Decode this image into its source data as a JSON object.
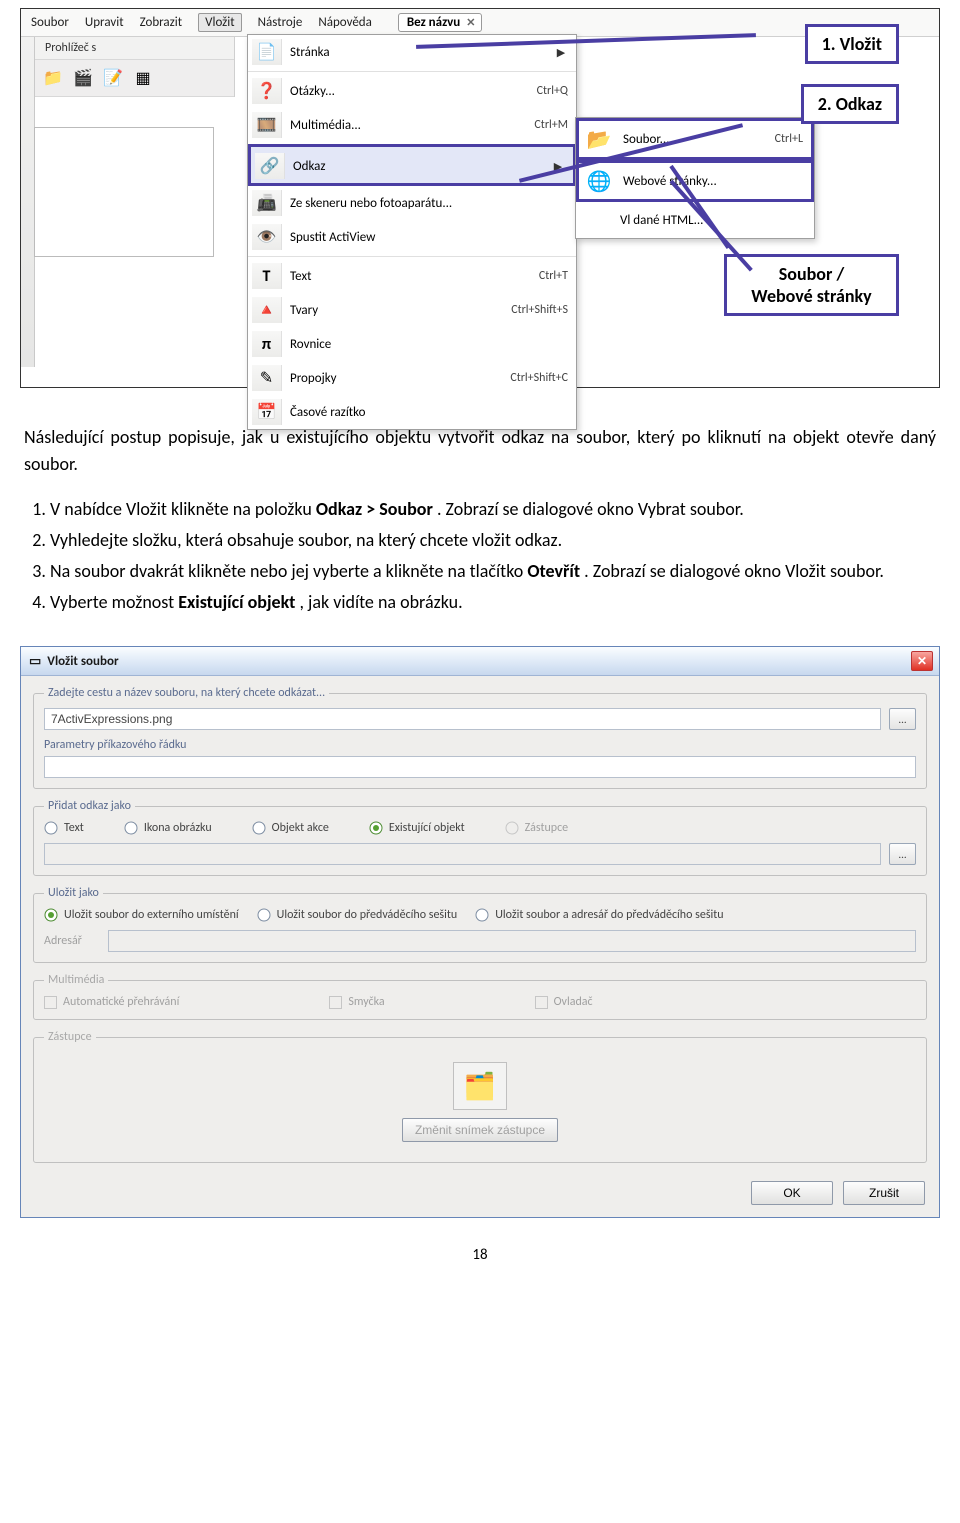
{
  "menubar": {
    "file": "Soubor",
    "edit": "Upravit",
    "view": "Zobrazit",
    "insert": "Vložit",
    "tools": "Nástroje",
    "help": "Nápověda",
    "tab_name": "Bez názvu"
  },
  "side_panel": {
    "title": "Prohlížeč s"
  },
  "dropdown": {
    "page": "Stránka",
    "questions": "Otázky...",
    "questions_sc": "Ctrl+Q",
    "multimedia": "Multimédia...",
    "multimedia_sc": "Ctrl+M",
    "link": "Odkaz",
    "scanner": "Ze skeneru nebo fotoaparátu...",
    "actiview": "Spustit ActiView",
    "text": "Text",
    "text_sc": "Ctrl+T",
    "shapes": "Tvary",
    "shapes_sc": "Ctrl+Shift+S",
    "equation": "Rovnice",
    "connectors": "Propojky",
    "connectors_sc": "Ctrl+Shift+C",
    "timestamp": "Časové razítko"
  },
  "submenu": {
    "file": "Soubor...",
    "file_sc": "Ctrl+L",
    "web": "Webové stránky...",
    "html": "Vl   dané HTML..."
  },
  "callouts": {
    "c1": "1. Vložit",
    "c2": "2. Odkaz",
    "c3_line1": "Soubor /",
    "c3_line2": "Webové stránky"
  },
  "body": {
    "intro": "Následující postup popisuje, jak u existujícího objektu vytvořit odkaz na soubor, který po kliknutí na objekt otevře daný soubor.",
    "li1a": "V nabídce Vložit klikněte na položku ",
    "li1b": "Odkaz > Soubor",
    "li1c": ". Zobrazí se dialogové okno Vybrat soubor.",
    "li2": "Vyhledejte složku, která obsahuje soubor, na který chcete vložit odkaz.",
    "li3a": "Na soubor dvakrát klikněte nebo jej vyberte a klikněte na tlačítko ",
    "li3b": "Otevřít",
    "li3c": ". Zobrazí se dialogové okno Vložit soubor.",
    "li4a": "Vyberte možnost ",
    "li4b": "Existující objekt",
    "li4c": ", jak vidíte na obrázku."
  },
  "dialog": {
    "title": "Vložit soubor",
    "fs1_legend": "Zadejte cestu a název souboru, na který chcete odkázat...",
    "file_value": "7ActivExpressions.png",
    "browse": "...",
    "params_label": "Parametry příkazového řádku",
    "fs2_legend": "Přidat odkaz jako",
    "opt_text": "Text",
    "opt_icon": "Ikona obrázku",
    "opt_action": "Objekt akce",
    "opt_existing": "Existující objekt",
    "opt_shortcut": "Zástupce",
    "fs3_legend": "Uložit jako",
    "s1": "Uložit soubor do externího umístění",
    "s2": "Uložit soubor do předváděcího sešitu",
    "s3": "Uložit soubor a adresář do předváděcího sešitu",
    "dir_label": "Adresář",
    "fs4_legend": "Multimédia",
    "m1": "Automatické přehrávání",
    "m2": "Smyčka",
    "m3": "Ovladač",
    "fs5_legend": "Zástupce",
    "ph_btn": "Změnit snímek zástupce",
    "ok": "OK",
    "cancel": "Zrušit"
  },
  "page_number": "18"
}
